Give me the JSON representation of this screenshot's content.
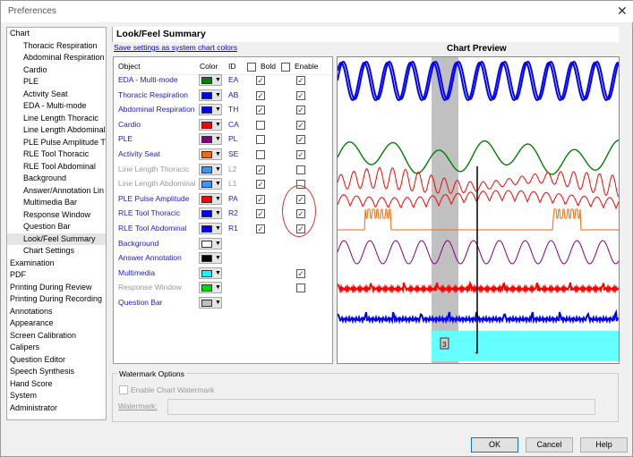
{
  "window": {
    "title": "Preferences",
    "close": "✕"
  },
  "tree": [
    {
      "label": "Chart",
      "level": 0
    },
    {
      "label": "Thoracic Respiration",
      "level": 1
    },
    {
      "label": "Abdominal Respiration",
      "level": 1
    },
    {
      "label": "Cardio",
      "level": 1
    },
    {
      "label": "PLE",
      "level": 1
    },
    {
      "label": "Activity Seat",
      "level": 1
    },
    {
      "label": "EDA - Multi-mode",
      "level": 1
    },
    {
      "label": "Line Length Thoracic",
      "level": 1
    },
    {
      "label": "Line Length Abdominal",
      "level": 1
    },
    {
      "label": "PLE Pulse Amplitude T",
      "level": 1
    },
    {
      "label": "RLE Tool Thoracic",
      "level": 1
    },
    {
      "label": "RLE Tool Abdominal",
      "level": 1
    },
    {
      "label": "Background",
      "level": 1
    },
    {
      "label": "Answer/Annotation Lin",
      "level": 1
    },
    {
      "label": "Multimedia Bar",
      "level": 1
    },
    {
      "label": "Response Window",
      "level": 1
    },
    {
      "label": "Question Bar",
      "level": 1
    },
    {
      "label": "Look/Feel Summary",
      "level": 1,
      "selected": true
    },
    {
      "label": "Chart Settings",
      "level": 1
    },
    {
      "label": "Examination",
      "level": 0
    },
    {
      "label": "PDF",
      "level": 0
    },
    {
      "label": "Printing During Review",
      "level": 0
    },
    {
      "label": "Printing During Recording",
      "level": 0
    },
    {
      "label": "Annotations",
      "level": 0
    },
    {
      "label": "Appearance",
      "level": 0
    },
    {
      "label": "Screen Calibration",
      "level": 0
    },
    {
      "label": "Calipers",
      "level": 0
    },
    {
      "label": "Question Editor",
      "level": 0
    },
    {
      "label": "Speech Synthesis",
      "level": 0
    },
    {
      "label": "Hand Score",
      "level": 0
    },
    {
      "label": "System",
      "level": 0
    },
    {
      "label": "Administrator",
      "level": 0
    }
  ],
  "panel": {
    "title": "Look/Feel Summary",
    "save_link": "Save settings as system chart colors",
    "preview_title": "Chart Preview"
  },
  "table": {
    "headers": {
      "object": "Object",
      "color": "Color",
      "id": "ID",
      "bold": "Bold",
      "enable": "Enable"
    },
    "rows": [
      {
        "object": "EDA - Multi-mode",
        "color": "#008000",
        "id": "EA",
        "bold": true,
        "enable": true,
        "disabled": false
      },
      {
        "object": "Thoracic Respiration",
        "color": "#0000ff",
        "id": "AB",
        "bold": true,
        "enable": true,
        "disabled": false
      },
      {
        "object": "Abdominal Respiration",
        "color": "#0000ff",
        "id": "TH",
        "bold": true,
        "enable": true,
        "disabled": false
      },
      {
        "object": "Cardio",
        "color": "#ff0000",
        "id": "CA",
        "bold": false,
        "enable": true,
        "disabled": false
      },
      {
        "object": "PLE",
        "color": "#800080",
        "id": "PL",
        "bold": false,
        "enable": true,
        "disabled": false
      },
      {
        "object": "Activity Seat",
        "color": "#ff6600",
        "id": "SE",
        "bold": false,
        "enable": true,
        "disabled": false
      },
      {
        "object": "Line Length Thoracic",
        "color": "#3399ff",
        "id": "L2",
        "bold": true,
        "enable": false,
        "disabled": true
      },
      {
        "object": "Line Length Abdominal",
        "color": "#3399ff",
        "id": "L1",
        "bold": true,
        "enable": false,
        "disabled": true
      },
      {
        "object": "PLE Pulse Amplitude",
        "color": "#ff0000",
        "id": "PA",
        "bold": true,
        "enable": true,
        "disabled": false
      },
      {
        "object": "RLE Tool Thoracic",
        "color": "#0000ff",
        "id": "R2",
        "bold": true,
        "enable": true,
        "disabled": false
      },
      {
        "object": "RLE Tool Abdominal",
        "color": "#0000ff",
        "id": "R1",
        "bold": true,
        "enable": true,
        "disabled": false
      },
      {
        "object": "Background",
        "color": "#ffffff",
        "id": "",
        "disabled": false
      },
      {
        "object": "Answer Annotation",
        "color": "#000000",
        "id": "",
        "disabled": false
      },
      {
        "object": "Multimedia",
        "color": "#00ffff",
        "id": "",
        "enable": true,
        "disabled": false
      },
      {
        "object": "Response Window",
        "color": "#00dd00",
        "id": "",
        "enable": false,
        "disabled": true
      },
      {
        "object": "Question Bar",
        "color": "#c0c0c0",
        "id": "",
        "disabled": false
      }
    ]
  },
  "preview": {
    "question_label": "3",
    "marker": "+"
  },
  "watermark": {
    "group": "Watermark Options",
    "enable_label": "Enable Chart Watermark",
    "field_label": "Watermark:",
    "value": ""
  },
  "buttons": {
    "ok": "OK",
    "cancel": "Cancel",
    "help": "Help"
  }
}
